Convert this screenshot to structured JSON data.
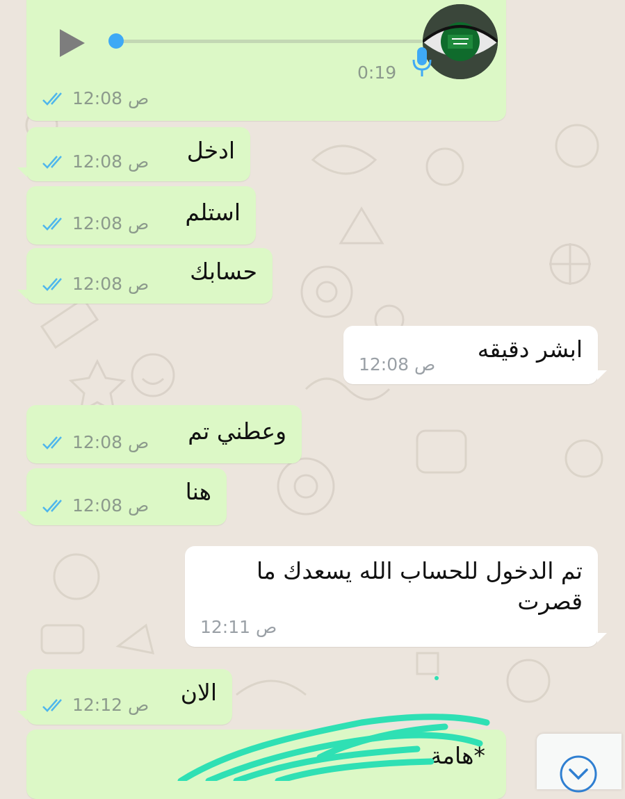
{
  "colors": {
    "background": "#ece5dd",
    "outgoing_bubble": "#dcf8c6",
    "incoming_bubble": "#ffffff",
    "read_ticks": "#4fb6ec",
    "time_text": "#8c9a8c",
    "scribble": "#2fe0b4"
  },
  "voice_message": {
    "duration": "0:19",
    "time": "12:08",
    "am_pm": "ص",
    "progress": 0,
    "icons": [
      "play-icon",
      "microphone-icon",
      "avatar-eye-flag"
    ]
  },
  "messages": [
    {
      "direction": "outgoing",
      "text": "ادخل",
      "time": "12:08",
      "am_pm": "ص",
      "status": "read"
    },
    {
      "direction": "outgoing",
      "text": "استلم",
      "time": "12:08",
      "am_pm": "ص",
      "status": "read"
    },
    {
      "direction": "outgoing",
      "text": "حسابك",
      "time": "12:08",
      "am_pm": "ص",
      "status": "read"
    },
    {
      "direction": "incoming",
      "text": "ابشر دقيقه",
      "time": "12:08",
      "am_pm": "ص"
    },
    {
      "direction": "outgoing",
      "text": "وعطني تم",
      "time": "12:08",
      "am_pm": "ص",
      "status": "read"
    },
    {
      "direction": "outgoing",
      "text": "هنا",
      "time": "12:08",
      "am_pm": "ص",
      "status": "read"
    },
    {
      "direction": "incoming",
      "text_line1": "تم الدخول للحساب الله يسعدك ما",
      "text_line2": "قصرت",
      "time": "12:11",
      "am_pm": "ص"
    },
    {
      "direction": "outgoing",
      "text": "الان",
      "time": "12:12",
      "am_pm": "ص",
      "status": "read"
    }
  ],
  "partial_message": {
    "visible_text": "*هامة",
    "note": ""
  },
  "scroll_down": {
    "icon": "chevron-down-circle-icon"
  }
}
